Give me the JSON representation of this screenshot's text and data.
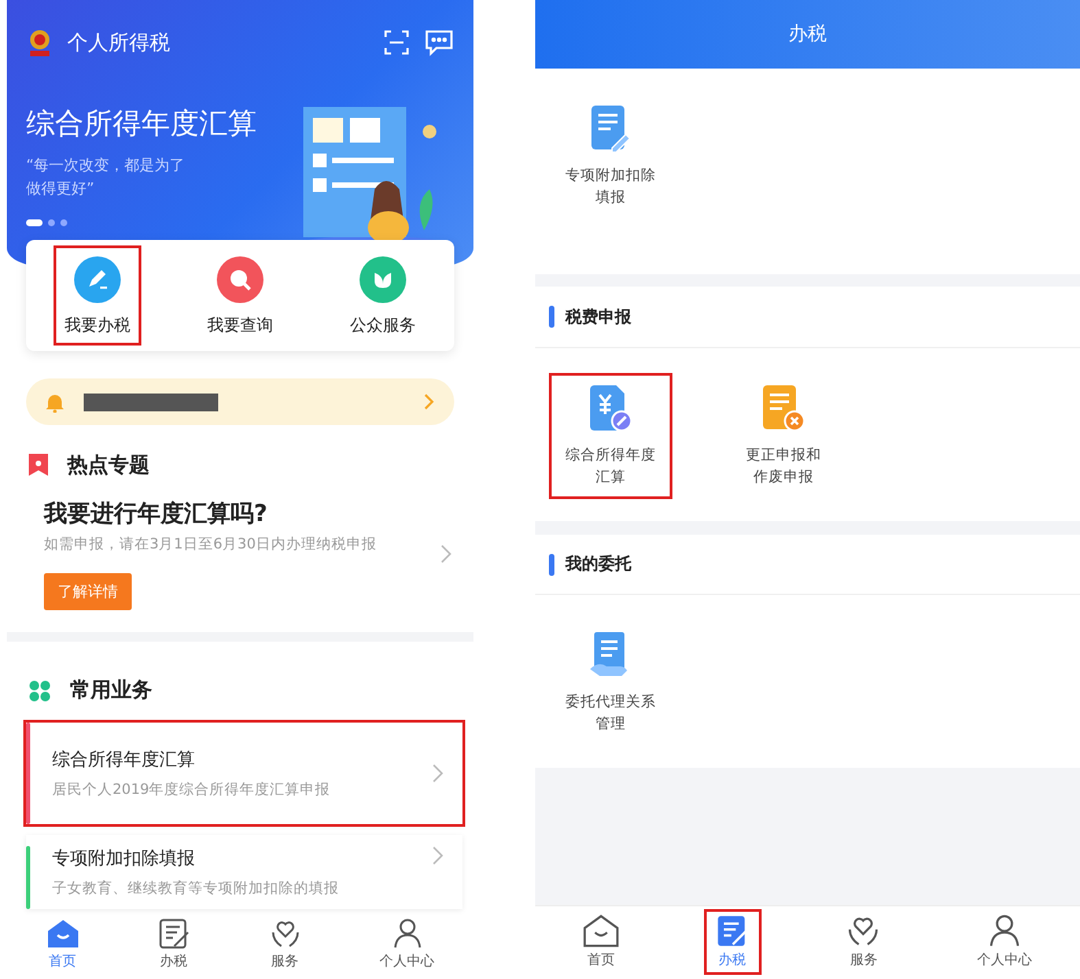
{
  "left": {
    "app_title": "个人所得税",
    "banner": {
      "title": "综合所得年度汇算",
      "quote_lines": [
        "“每一次改变，都是为了",
        "做得更好”"
      ],
      "dots": [
        {
          "selected": true
        },
        {
          "selected": false
        },
        {
          "selected": false
        }
      ]
    },
    "quick_actions": [
      {
        "label": "我要办税",
        "kind": "pen",
        "highlighted": true
      },
      {
        "label": "我要查询",
        "kind": "search",
        "highlighted": false
      },
      {
        "label": "公众服务",
        "kind": "leaf",
        "highlighted": false
      }
    ],
    "hot_topic": {
      "section_title": "热点专题",
      "headline": "我要进行年度汇算吗?",
      "subtitle": "如需申报，请在3月1日至6月30日内办理纳税申报",
      "button": "了解详情"
    },
    "common": {
      "section_title": "常用业务",
      "items": [
        {
          "title": "综合所得年度汇算",
          "subtitle": "居民个人2019年度综合所得年度汇算申报",
          "color": "#f0506e",
          "highlighted": true
        },
        {
          "title": "专项附加扣除填报",
          "subtitle": "子女教育、继续教育等专项附加扣除的填报",
          "color": "#3ccf7a",
          "highlighted": false
        }
      ]
    },
    "tabbar": [
      {
        "label": "首页",
        "kind": "home",
        "selected": true
      },
      {
        "label": "办税",
        "kind": "doc",
        "selected": false
      },
      {
        "label": "服务",
        "kind": "heart",
        "selected": false
      },
      {
        "label": "个人中心",
        "kind": "person",
        "selected": false
      }
    ]
  },
  "right": {
    "header_title": "办税",
    "top_items": [
      {
        "lines": [
          "专项附加扣除",
          "填报"
        ],
        "kind": "doc-pen",
        "highlighted": false
      }
    ],
    "sections": [
      {
        "title": "税费申报",
        "items": [
          {
            "lines": [
              "综合所得年度",
              "汇算"
            ],
            "kind": "yen-doc",
            "highlighted": true
          },
          {
            "lines": [
              "更正申报和",
              "作废申报"
            ],
            "kind": "doc-x",
            "highlighted": false
          }
        ]
      },
      {
        "title": "我的委托",
        "items": [
          {
            "lines": [
              "委托代理关系",
              "管理"
            ],
            "kind": "doc-hand",
            "highlighted": false
          }
        ]
      }
    ],
    "tabbar": [
      {
        "label": "首页",
        "kind": "home",
        "selected": false,
        "highlighted": false
      },
      {
        "label": "办税",
        "kind": "doc",
        "selected": true,
        "highlighted": true
      },
      {
        "label": "服务",
        "kind": "heart",
        "selected": false,
        "highlighted": false
      },
      {
        "label": "个人中心",
        "kind": "person",
        "selected": false,
        "highlighted": false
      }
    ]
  }
}
